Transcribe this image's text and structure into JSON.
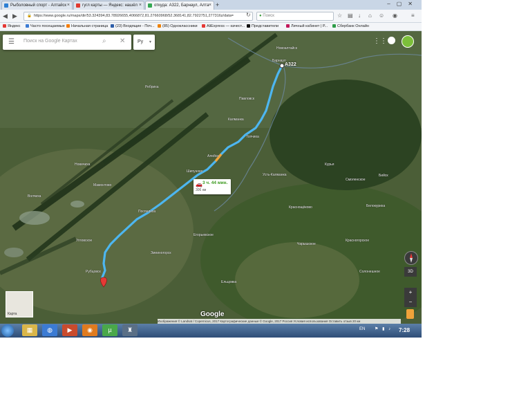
{
  "browser": {
    "tabs": [
      {
        "title": "Рыболовный спорт - Алтайск"
      },
      {
        "title": "гугл карты — Яндекс: нашёл"
      },
      {
        "title": "откуда: A322, Барнаул, Алта"
      }
    ],
    "new_tab_label": "+",
    "url": "https://www.google.ru/maps/dir/53.324394,83.78926655,4066872,81.27660968/52.368141,82.7922751,277316z/data=",
    "search_placeholder": "Поиск",
    "bookmarks": [
      "Яндекс",
      "Часто посещаемые",
      "Начальная страница",
      "(23) Входящие - Поч...",
      "(85) Одноклассники",
      "AliExpress — качест...",
      "Представители",
      "Личный кабинет | Р...",
      "Сбербанк Онлайн"
    ]
  },
  "maps": {
    "search_placeholder": "Поиск на Google Картах",
    "language": "Ру",
    "route": {
      "duration": "3 ч. 44 мин.",
      "distance": "306 км",
      "road_label": "A322",
      "route_color": "#4db6f0"
    },
    "layer_thumb_label": "Карта",
    "logo": "Google",
    "tilt_label": "3D",
    "zoom_in": "+",
    "zoom_out": "−",
    "attribution": "Изображения © Landsat / Copernicus, 2017 Картографические данные © Google, 2017   Россия   Условия использования   Оставить отзыв   20 км",
    "place_labels": [
      "Новоалтайск",
      "Барнаул",
      "Калманка",
      "Алейск",
      "Рубцовск",
      "Шипуново",
      "Курья",
      "Краснощёково",
      "Угловское",
      "Змеиногорск",
      "Мамонтово",
      "Ребриха",
      "Павловск",
      "Топчиха",
      "Поспелиха",
      "Новичиха",
      "Волчиха",
      "Егорьевское",
      "Бийск",
      "Смоленское",
      "Белокуриха",
      "Красногорское",
      "Солонешное",
      "Чарышское",
      "Усть-Калманка",
      "Ельцовка"
    ]
  },
  "taskbar": {
    "language": "EN",
    "time": "7:28"
  }
}
